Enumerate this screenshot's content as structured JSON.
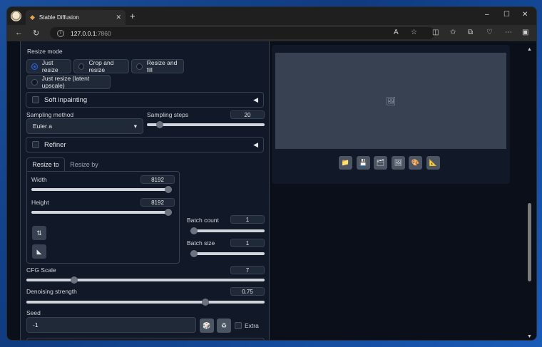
{
  "browser": {
    "tab_title": "Stable Diffusion",
    "tab_close": "✕",
    "new_tab": "+",
    "url_host": "127.0.0.1",
    "url_port": ":7860",
    "win_minimize": "–",
    "win_maximize": "☐",
    "win_close": "✕"
  },
  "left": {
    "resize_mode_label": "Resize mode",
    "resize_modes": [
      {
        "label": "Just resize",
        "selected": true
      },
      {
        "label": "Crop and resize",
        "selected": false
      },
      {
        "label": "Resize and fill",
        "selected": false
      },
      {
        "label": "Just resize (latent upscale)",
        "selected": false
      }
    ],
    "soft_inpainting_label": "Soft inpainting",
    "sampling_method_label": "Sampling method",
    "sampling_method_value": "Euler a",
    "sampling_steps_label": "Sampling steps",
    "sampling_steps_value": "20",
    "sampling_steps_fraction": 0.11,
    "refiner_label": "Refiner",
    "tab_resize_to": "Resize to",
    "tab_resize_by": "Resize by",
    "width_label": "Width",
    "width_value": "8192",
    "width_fraction": 1.0,
    "height_label": "Height",
    "height_value": "8192",
    "height_fraction": 1.0,
    "batch_count_label": "Batch count",
    "batch_count_value": "1",
    "batch_count_fraction": 0.0,
    "batch_size_label": "Batch size",
    "batch_size_value": "1",
    "batch_size_fraction": 0.0,
    "cfg_label": "CFG Scale",
    "cfg_value": "7",
    "cfg_fraction": 0.2,
    "denoise_label": "Denoising strength",
    "denoise_value": "0.75",
    "denoise_fraction": 0.75,
    "seed_label": "Seed",
    "seed_value": "-1",
    "extra_label": "Extra"
  },
  "icons": {
    "swap": "⇅",
    "ratio": "◣",
    "dice": "🎲",
    "recycle": "♻",
    "collapse": "◀",
    "dropdown": "▾",
    "image_placeholder": "🖼"
  },
  "output_tools": [
    "📁",
    "💾",
    "🗂",
    "🖼",
    "🎨",
    "📐"
  ]
}
